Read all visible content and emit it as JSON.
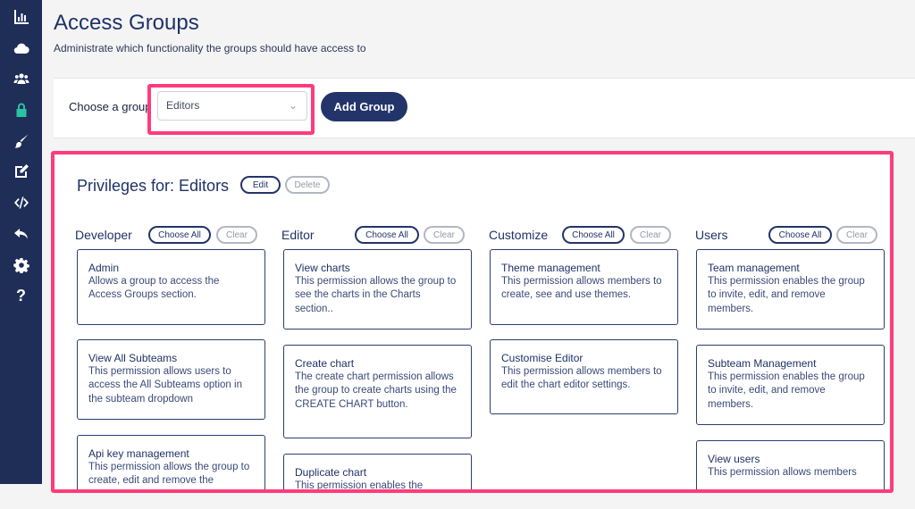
{
  "sidebar": {
    "icons": [
      "analytics-icon",
      "cloud-icon",
      "users-icon",
      "lock-icon",
      "brush-icon",
      "edit-icon",
      "code-icon",
      "undo-icon",
      "gear-icon",
      "help-icon"
    ],
    "help_glyph": "?",
    "active_color": "#2bc1a3",
    "bg_color": "#1e2e57"
  },
  "header": {
    "title": "Access Groups",
    "subtitle": "Administrate which functionality the groups should have access to"
  },
  "group_bar": {
    "label": "Choose a group",
    "selected": "Editors",
    "add_button": "Add Group"
  },
  "privileges": {
    "title": "Privileges for: Editors",
    "edit_label": "Edit",
    "delete_label": "Delete",
    "choose_all": "Choose All",
    "clear": "Clear",
    "columns": [
      {
        "name": "Developer",
        "cards": [
          {
            "title": "Admin",
            "desc": "Allows a group to access the Access Groups section."
          },
          {
            "title": "View All Subteams",
            "desc": "This permission allows users to access the All Subteams option in the subteam dropdown"
          },
          {
            "title": "Api key management",
            "desc": "This permission allows the group to create, edit and remove the"
          }
        ]
      },
      {
        "name": "Editor",
        "cards": [
          {
            "title": "View charts",
            "desc": "This permission allows the group to see the charts in the Charts section.."
          },
          {
            "title": "Create chart",
            "desc": "The create chart permission allows the group to create charts using the CREATE CHART button."
          },
          {
            "title": "Duplicate chart",
            "desc": "This permission enables the"
          }
        ]
      },
      {
        "name": "Customize",
        "cards": [
          {
            "title": "Theme management",
            "desc": "This permission allows members to create, see and use themes."
          },
          {
            "title": "Customise Editor",
            "desc": "This permission allows members to edit the chart editor settings."
          }
        ]
      },
      {
        "name": "Users",
        "cards": [
          {
            "title": "Team management",
            "desc": "This permission enables the group to invite, edit, and remove members."
          },
          {
            "title": "Subteam Management",
            "desc": "This permission enables the group to invite, edit, and remove members."
          },
          {
            "title": "View users",
            "desc": "This permission allows members"
          }
        ]
      }
    ]
  },
  "colors": {
    "accent": "#22346a",
    "highlight": "#ff3c7b"
  }
}
